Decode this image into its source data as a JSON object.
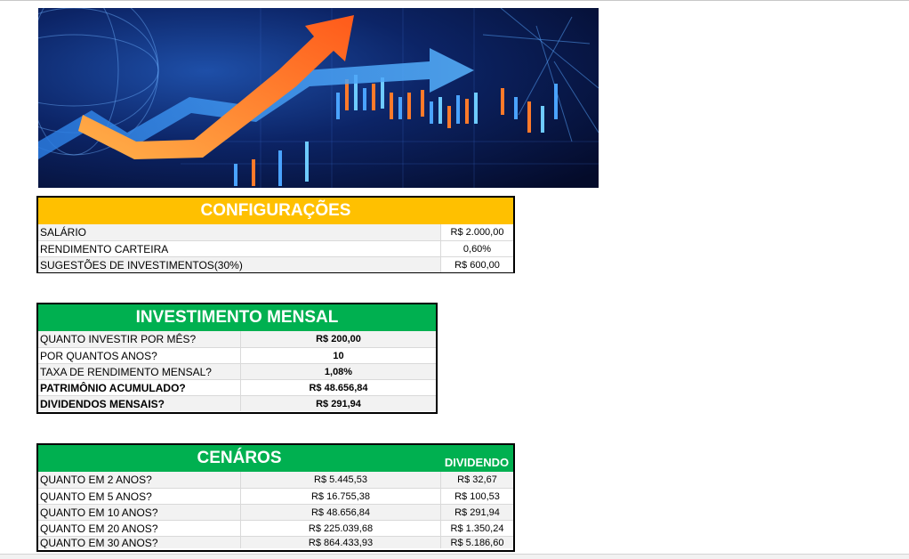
{
  "configuracoes": {
    "title": "CONFIGURAÇÕES",
    "rows": [
      {
        "label": "SALÁRIO",
        "value": "R$ 2.000,00"
      },
      {
        "label": "RENDIMENTO CARTEIRA",
        "value": "0,60%"
      },
      {
        "label": "SUGESTÕES DE INVESTIMENTOS(30%)",
        "value": "R$ 600,00"
      }
    ]
  },
  "investimento": {
    "title": "INVESTIMENTO MENSAL",
    "rows": [
      {
        "label": "QUANTO INVESTIR POR MÊS?",
        "value": "R$ 200,00"
      },
      {
        "label": "POR QUANTOS ANOS?",
        "value": "10"
      },
      {
        "label": "TAXA DE RENDIMENTO MENSAL?",
        "value": "1,08%"
      },
      {
        "label": "PATRIMÔNIO ACUMULADO?",
        "value": "R$ 48.656,84"
      },
      {
        "label": "DIVIDENDOS MENSAIS?",
        "value": "R$ 291,94"
      }
    ]
  },
  "cenarios": {
    "title": "CENÁROS",
    "dividend_header": "DIVIDENDO",
    "rows": [
      {
        "label": "QUANTO EM 2 ANOS?",
        "value": "R$ 5.445,53",
        "dividend": "R$ 32,67"
      },
      {
        "label": "QUANTO EM 5 ANOS?",
        "value": "R$ 16.755,38",
        "dividend": "R$ 100,53"
      },
      {
        "label": "QUANTO EM 10 ANOS?",
        "value": "R$ 48.656,84",
        "dividend": "R$ 291,94"
      },
      {
        "label": "QUANTO EM 20 ANOS?",
        "value": "R$ 225.039,68",
        "dividend": "R$ 1.350,24"
      },
      {
        "label": "QUANTO EM 30 ANOS?",
        "value": "R$ 864.433,93",
        "dividend": "R$ 5.186,60"
      }
    ]
  },
  "colors": {
    "orange": "#ffc000",
    "green": "#00b050",
    "banner_bg": "#0a1a4a"
  }
}
